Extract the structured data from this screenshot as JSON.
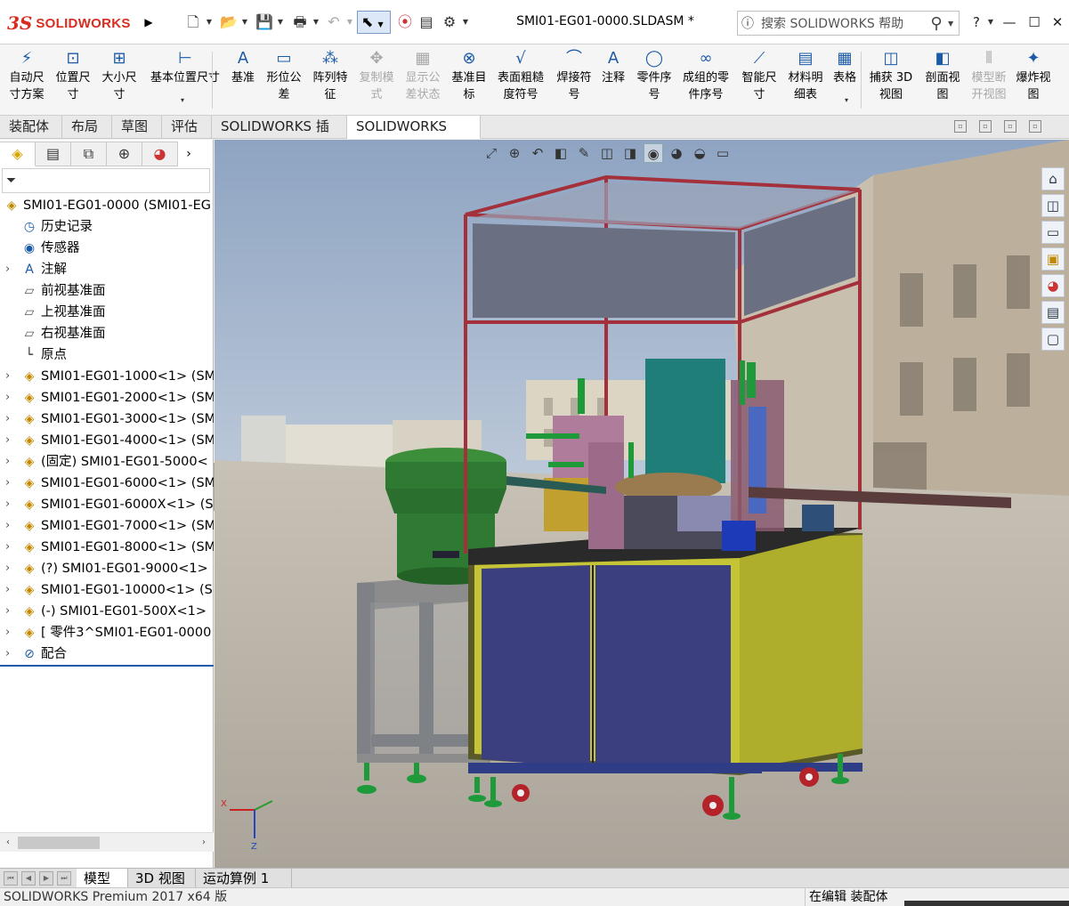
{
  "app": {
    "brand_ds": "3S",
    "brand": "SOLIDWORKS",
    "document_title": "SMI01-EG01-0000.SLDASM *"
  },
  "search": {
    "placeholder": "搜索 SOLIDWORKS 帮助"
  },
  "window_controls": {
    "help": "?",
    "minimize": "—",
    "maximize": "☐",
    "close": "✕"
  },
  "commands": [
    {
      "label": "自动尺\n寸方案",
      "icon": "auto-dimension-icon",
      "glyph": "⚡"
    },
    {
      "label": "位置尺\n寸",
      "icon": "location-dimension-icon",
      "glyph": "⊡"
    },
    {
      "label": "大小尺\n寸",
      "icon": "size-dimension-icon",
      "glyph": "⊞"
    },
    {
      "label": "基本位置尺寸",
      "icon": "basic-location-dimension-icon",
      "glyph": "⊢"
    },
    {
      "label": "基准",
      "icon": "datum-icon",
      "glyph": "A"
    },
    {
      "label": "形位公\n差",
      "icon": "geometric-tolerance-icon",
      "glyph": "▭"
    },
    {
      "label": "阵列特\n征",
      "icon": "pattern-feature-icon",
      "glyph": "⁂"
    },
    {
      "label": "复制模\n式",
      "icon": "copy-scheme-icon",
      "glyph": "✥",
      "disabled": true
    },
    {
      "label": "显示公\n差状态",
      "icon": "show-tolerance-status-icon",
      "glyph": "▦",
      "disabled": true
    },
    {
      "label": "基准目\n标",
      "icon": "datum-target-icon",
      "glyph": "⊗"
    },
    {
      "label": "表面粗糙\n度符号",
      "icon": "surface-finish-icon",
      "glyph": "√"
    },
    {
      "label": "焊接符\n号",
      "icon": "weld-symbol-icon",
      "glyph": "⌒"
    },
    {
      "label": "注释",
      "icon": "note-icon",
      "glyph": "A"
    },
    {
      "label": "零件序\n号",
      "icon": "balloon-icon",
      "glyph": "◯"
    },
    {
      "label": "成组的零\n件序号",
      "icon": "stacked-balloon-icon",
      "glyph": "∞"
    },
    {
      "label": "智能尺\n寸",
      "icon": "smart-dimension-icon",
      "glyph": "⟋"
    },
    {
      "label": "材料明\n细表",
      "icon": "bom-icon",
      "glyph": "▤"
    },
    {
      "label": "表格",
      "icon": "table-icon",
      "glyph": "▦"
    },
    {
      "label": "捕获 3D\n视图",
      "icon": "capture-3d-view-icon",
      "glyph": "◫"
    },
    {
      "label": "剖面视\n图",
      "icon": "section-view-icon",
      "glyph": "◧"
    },
    {
      "label": "模型断\n开视图",
      "icon": "broken-view-icon",
      "glyph": "⫴",
      "disabled": true
    },
    {
      "label": "爆炸视\n图",
      "icon": "exploded-view-icon",
      "glyph": "✦"
    }
  ],
  "tabs": [
    "装配体",
    "布局",
    "草图",
    "评估",
    "SOLIDWORKS 插件",
    "SOLIDWORKS MBD"
  ],
  "tree": [
    {
      "text": "SMI01-EG01-0000  (SMI01-EG",
      "icon": "assembly-icon",
      "glyph": "◈",
      "level": 0,
      "expand": false
    },
    {
      "text": "历史记录",
      "icon": "history-icon",
      "glyph": "◷",
      "level": 1,
      "expand": false
    },
    {
      "text": "传感器",
      "icon": "sensor-icon",
      "glyph": "◉",
      "level": 1,
      "expand": false
    },
    {
      "text": "注解",
      "icon": "annotations-icon",
      "glyph": "A",
      "level": 1,
      "expand": true
    },
    {
      "text": "前视基准面",
      "icon": "plane-icon",
      "glyph": "▱",
      "level": 1,
      "expand": false
    },
    {
      "text": "上视基准面",
      "icon": "plane-icon",
      "glyph": "▱",
      "level": 1,
      "expand": false
    },
    {
      "text": "右视基准面",
      "icon": "plane-icon",
      "glyph": "▱",
      "level": 1,
      "expand": false
    },
    {
      "text": "原点",
      "icon": "origin-icon",
      "glyph": "└",
      "level": 1,
      "expand": false
    },
    {
      "text": "SMI01-EG01-1000<1> (SM",
      "icon": "subassembly-icon",
      "glyph": "◈",
      "level": 1,
      "expand": true
    },
    {
      "text": "SMI01-EG01-2000<1> (SM",
      "icon": "subassembly-icon",
      "glyph": "◈",
      "level": 1,
      "expand": true
    },
    {
      "text": "SMI01-EG01-3000<1> (SM",
      "icon": "subassembly-icon",
      "glyph": "◈",
      "level": 1,
      "expand": true
    },
    {
      "text": "SMI01-EG01-4000<1> (SM",
      "icon": "subassembly-icon",
      "glyph": "◈",
      "level": 1,
      "expand": true
    },
    {
      "text": "(固定) SMI01-EG01-5000<",
      "icon": "subassembly-icon",
      "glyph": "◈",
      "level": 1,
      "expand": true
    },
    {
      "text": "SMI01-EG01-6000<1> (SM",
      "icon": "subassembly-icon",
      "glyph": "◈",
      "level": 1,
      "expand": true
    },
    {
      "text": "SMI01-EG01-6000X<1> (S",
      "icon": "subassembly-icon",
      "glyph": "◈",
      "level": 1,
      "expand": true
    },
    {
      "text": "SMI01-EG01-7000<1> (SM",
      "icon": "subassembly-icon",
      "glyph": "◈",
      "level": 1,
      "expand": true
    },
    {
      "text": "SMI01-EG01-8000<1> (SM",
      "icon": "subassembly-icon",
      "glyph": "◈",
      "level": 1,
      "expand": true
    },
    {
      "text": "(?) SMI01-EG01-9000<1>",
      "icon": "subassembly-warning-icon",
      "glyph": "◈",
      "level": 1,
      "expand": true
    },
    {
      "text": "SMI01-EG01-10000<1> (S",
      "icon": "subassembly-icon",
      "glyph": "◈",
      "level": 1,
      "expand": true
    },
    {
      "text": "(-) SMI01-EG01-500X<1>",
      "icon": "subassembly-icon",
      "glyph": "◈",
      "level": 1,
      "expand": true
    },
    {
      "text": "[ 零件3^SMI01-EG01-0000",
      "icon": "part-icon",
      "glyph": "◈",
      "level": 1,
      "expand": true
    },
    {
      "text": "配合",
      "icon": "mates-icon",
      "glyph": "⊘",
      "level": 1,
      "expand": true
    }
  ],
  "bottom_tabs": [
    "模型",
    "3D 视图",
    "运动算例 1"
  ],
  "status": {
    "left": "SOLIDWORKS Premium 2017 x64 版",
    "right": "在编辑 装配体"
  },
  "colors": {
    "brand_red": "#d62d20",
    "accent_blue": "#1b5aa6"
  }
}
